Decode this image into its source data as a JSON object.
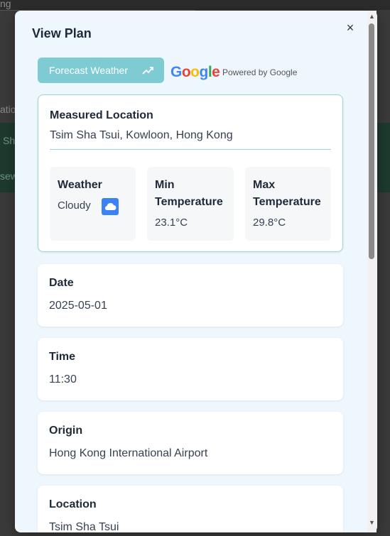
{
  "background": {
    "top_text": "ng",
    "side_texts": [
      "atio",
      "Sh",
      "sew"
    ]
  },
  "modal": {
    "title": "View Plan",
    "close_glyph": "×",
    "forecast_button": "Forecast Weather",
    "google_logo": [
      "G",
      "o",
      "o",
      "g",
      "l",
      "e"
    ],
    "powered_by": "Powered by Google",
    "location_card": {
      "label": "Measured Location",
      "value": "Tsim Sha Tsui, Kowloon, Hong Kong",
      "weather": {
        "label": "Weather",
        "value": "Cloudy",
        "icon": "cloud-icon"
      },
      "min": {
        "label_line1": "Min",
        "label_line2": "Temperature",
        "value": "23.1°C"
      },
      "max": {
        "label_line1": "Max",
        "label_line2": "Temperature",
        "value": "29.8°C"
      }
    },
    "date": {
      "label": "Date",
      "value": "2025-05-01"
    },
    "time": {
      "label": "Time",
      "value": "11:30"
    },
    "origin": {
      "label": "Origin",
      "value": "Hong Kong International Airport"
    },
    "location": {
      "label": "Location",
      "value": "Tsim Sha Tsui"
    }
  },
  "colors": {
    "accent": "#7fcbd3",
    "modal_bg": "#eef7fd",
    "cloud_icon": "#3b82f6"
  }
}
